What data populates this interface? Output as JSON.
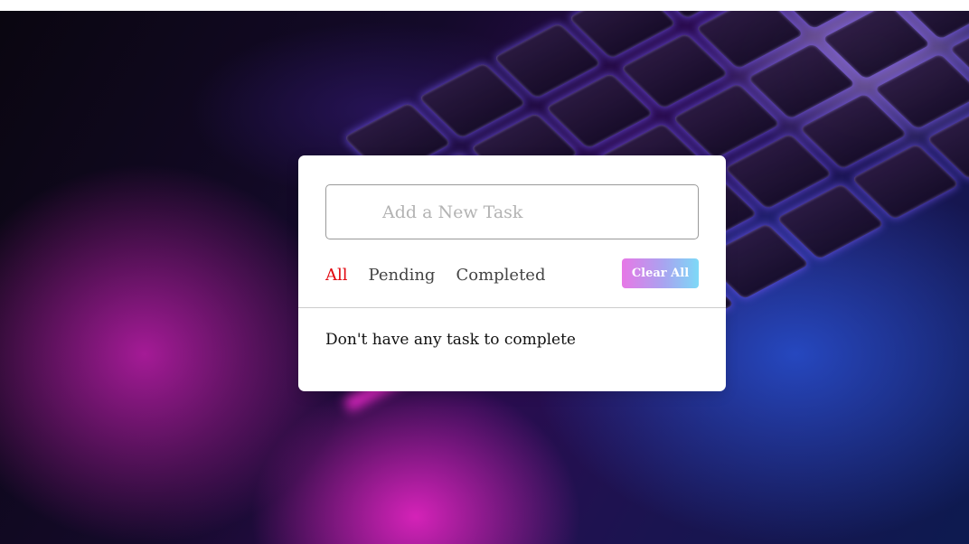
{
  "task_input": {
    "placeholder": "Add a New Task",
    "value": ""
  },
  "filters": [
    {
      "label": "All",
      "active": true
    },
    {
      "label": "Pending",
      "active": false
    },
    {
      "label": "Completed",
      "active": false
    }
  ],
  "clear_button": {
    "label": "Clear All"
  },
  "task_list": {
    "empty_message": "Don't have any task to complete"
  },
  "colors": {
    "active_filter": "#e1050d",
    "button_gradient_start": "#e778e6",
    "button_gradient_end": "#7dd9f7"
  }
}
